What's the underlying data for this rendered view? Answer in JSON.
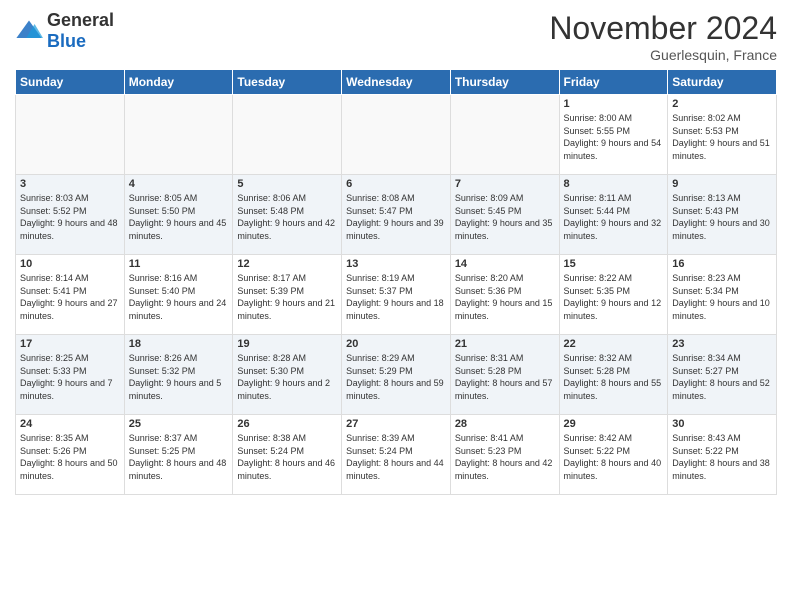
{
  "header": {
    "logo_general": "General",
    "logo_blue": "Blue",
    "title": "November 2024",
    "location": "Guerlesquin, France"
  },
  "days_of_week": [
    "Sunday",
    "Monday",
    "Tuesday",
    "Wednesday",
    "Thursday",
    "Friday",
    "Saturday"
  ],
  "weeks": [
    [
      {
        "day": "",
        "empty": true
      },
      {
        "day": "",
        "empty": true
      },
      {
        "day": "",
        "empty": true
      },
      {
        "day": "",
        "empty": true
      },
      {
        "day": "",
        "empty": true
      },
      {
        "day": "1",
        "sunrise": "8:00 AM",
        "sunset": "5:55 PM",
        "daylight": "9 hours and 54 minutes."
      },
      {
        "day": "2",
        "sunrise": "8:02 AM",
        "sunset": "5:53 PM",
        "daylight": "9 hours and 51 minutes."
      }
    ],
    [
      {
        "day": "3",
        "sunrise": "8:03 AM",
        "sunset": "5:52 PM",
        "daylight": "9 hours and 48 minutes."
      },
      {
        "day": "4",
        "sunrise": "8:05 AM",
        "sunset": "5:50 PM",
        "daylight": "9 hours and 45 minutes."
      },
      {
        "day": "5",
        "sunrise": "8:06 AM",
        "sunset": "5:48 PM",
        "daylight": "9 hours and 42 minutes."
      },
      {
        "day": "6",
        "sunrise": "8:08 AM",
        "sunset": "5:47 PM",
        "daylight": "9 hours and 39 minutes."
      },
      {
        "day": "7",
        "sunrise": "8:09 AM",
        "sunset": "5:45 PM",
        "daylight": "9 hours and 35 minutes."
      },
      {
        "day": "8",
        "sunrise": "8:11 AM",
        "sunset": "5:44 PM",
        "daylight": "9 hours and 32 minutes."
      },
      {
        "day": "9",
        "sunrise": "8:13 AM",
        "sunset": "5:43 PM",
        "daylight": "9 hours and 30 minutes."
      }
    ],
    [
      {
        "day": "10",
        "sunrise": "8:14 AM",
        "sunset": "5:41 PM",
        "daylight": "9 hours and 27 minutes."
      },
      {
        "day": "11",
        "sunrise": "8:16 AM",
        "sunset": "5:40 PM",
        "daylight": "9 hours and 24 minutes."
      },
      {
        "day": "12",
        "sunrise": "8:17 AM",
        "sunset": "5:39 PM",
        "daylight": "9 hours and 21 minutes."
      },
      {
        "day": "13",
        "sunrise": "8:19 AM",
        "sunset": "5:37 PM",
        "daylight": "9 hours and 18 minutes."
      },
      {
        "day": "14",
        "sunrise": "8:20 AM",
        "sunset": "5:36 PM",
        "daylight": "9 hours and 15 minutes."
      },
      {
        "day": "15",
        "sunrise": "8:22 AM",
        "sunset": "5:35 PM",
        "daylight": "9 hours and 12 minutes."
      },
      {
        "day": "16",
        "sunrise": "8:23 AM",
        "sunset": "5:34 PM",
        "daylight": "9 hours and 10 minutes."
      }
    ],
    [
      {
        "day": "17",
        "sunrise": "8:25 AM",
        "sunset": "5:33 PM",
        "daylight": "9 hours and 7 minutes."
      },
      {
        "day": "18",
        "sunrise": "8:26 AM",
        "sunset": "5:32 PM",
        "daylight": "9 hours and 5 minutes."
      },
      {
        "day": "19",
        "sunrise": "8:28 AM",
        "sunset": "5:30 PM",
        "daylight": "9 hours and 2 minutes."
      },
      {
        "day": "20",
        "sunrise": "8:29 AM",
        "sunset": "5:29 PM",
        "daylight": "8 hours and 59 minutes."
      },
      {
        "day": "21",
        "sunrise": "8:31 AM",
        "sunset": "5:28 PM",
        "daylight": "8 hours and 57 minutes."
      },
      {
        "day": "22",
        "sunrise": "8:32 AM",
        "sunset": "5:28 PM",
        "daylight": "8 hours and 55 minutes."
      },
      {
        "day": "23",
        "sunrise": "8:34 AM",
        "sunset": "5:27 PM",
        "daylight": "8 hours and 52 minutes."
      }
    ],
    [
      {
        "day": "24",
        "sunrise": "8:35 AM",
        "sunset": "5:26 PM",
        "daylight": "8 hours and 50 minutes."
      },
      {
        "day": "25",
        "sunrise": "8:37 AM",
        "sunset": "5:25 PM",
        "daylight": "8 hours and 48 minutes."
      },
      {
        "day": "26",
        "sunrise": "8:38 AM",
        "sunset": "5:24 PM",
        "daylight": "8 hours and 46 minutes."
      },
      {
        "day": "27",
        "sunrise": "8:39 AM",
        "sunset": "5:24 PM",
        "daylight": "8 hours and 44 minutes."
      },
      {
        "day": "28",
        "sunrise": "8:41 AM",
        "sunset": "5:23 PM",
        "daylight": "8 hours and 42 minutes."
      },
      {
        "day": "29",
        "sunrise": "8:42 AM",
        "sunset": "5:22 PM",
        "daylight": "8 hours and 40 minutes."
      },
      {
        "day": "30",
        "sunrise": "8:43 AM",
        "sunset": "5:22 PM",
        "daylight": "8 hours and 38 minutes."
      }
    ]
  ]
}
